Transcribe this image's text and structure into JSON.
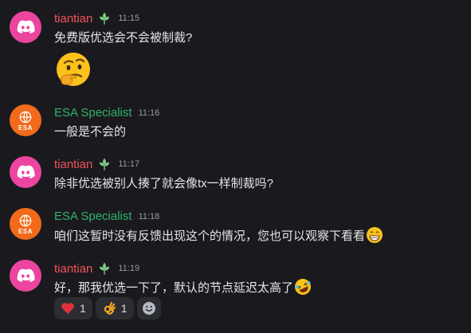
{
  "messages": [
    {
      "author": "tiantian",
      "time": "11:15",
      "text": "免费版优选会不会被制裁?",
      "avatar": "discord-logo",
      "badge": "leaf-badge"
    },
    {
      "author": "ESA Specialist",
      "time": "11:16",
      "text": "一般是不会的",
      "avatar": "esa-logo",
      "avatar_text": "ESA"
    },
    {
      "author": "tiantian",
      "time": "11:17",
      "text": "除非优选被别人揍了就会像tx一样制裁吗?",
      "avatar": "discord-logo",
      "badge": "leaf-badge"
    },
    {
      "author": "ESA Specialist",
      "time": "11:18",
      "text": "咱们这暂时没有反馈出现这个的情况，您也可以观察下看看",
      "avatar": "esa-logo",
      "avatar_text": "ESA"
    },
    {
      "author": "tiantian",
      "time": "11:19",
      "text": "好，那我优选一下了，默认的节点延迟太高了",
      "avatar": "discord-logo",
      "badge": "leaf-badge"
    }
  ],
  "reactions": [
    {
      "emoji": "heart",
      "count": "1"
    },
    {
      "emoji": "ok-hand",
      "count": "1"
    },
    {
      "emoji": "add-reaction"
    }
  ],
  "colors": {
    "background": "#1a1a1e",
    "discord_avatar": "#eb459f",
    "esa_avatar": "#f26a1b",
    "username_red": "#f2545b",
    "username_green": "#2fb36a",
    "timestamp": "#949ba4"
  }
}
